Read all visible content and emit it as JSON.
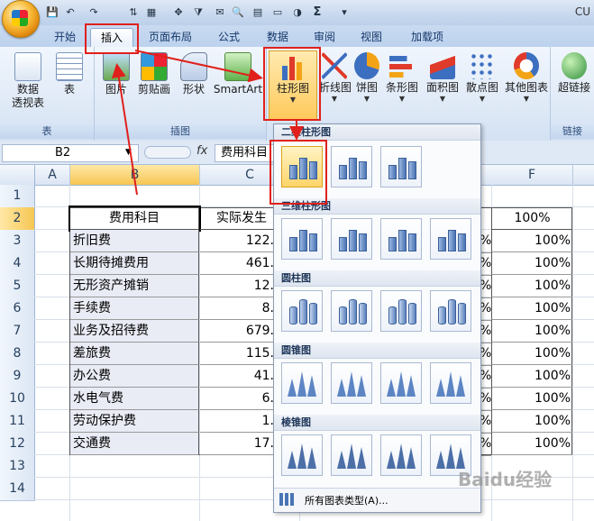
{
  "title_bar": {
    "app_title": "CU"
  },
  "tabs": [
    "开始",
    "插入",
    "页面布局",
    "公式",
    "数据",
    "审阅",
    "视图",
    "加载项"
  ],
  "ribbon": {
    "groups": {
      "table": {
        "label": "表",
        "buttons": [
          "数据\n透视表",
          "表"
        ]
      },
      "illustrations": {
        "label": "插图",
        "buttons": [
          "图片",
          "剪贴画",
          "形状",
          "SmartArt"
        ]
      },
      "charts": {
        "buttons": [
          "柱形图",
          "折线图",
          "饼图",
          "条形图",
          "面积图",
          "散点图",
          "其他图表"
        ]
      },
      "links": {
        "label": "链接",
        "buttons": [
          "超链接"
        ]
      }
    }
  },
  "formula_bar": {
    "name_box": "B2",
    "fx": "fx",
    "content": "费用科目"
  },
  "columns": [
    "A",
    "B",
    "C",
    "F"
  ],
  "rows": [
    "1",
    "2",
    "3",
    "4",
    "5",
    "6",
    "7",
    "8",
    "9",
    "10",
    "11",
    "12",
    "13",
    "14"
  ],
  "table": {
    "header_b": "费用科目",
    "header_c": "实际发生",
    "header_f": "100%",
    "rows": [
      {
        "b": "折旧费",
        "c": "122.",
        "e": "%",
        "f": "100%"
      },
      {
        "b": "长期待摊费用",
        "c": "461.",
        "e": "%",
        "f": "100%"
      },
      {
        "b": "无形资产摊销",
        "c": "12.",
        "e": "%",
        "f": "100%"
      },
      {
        "b": "手续费",
        "c": "8.",
        "e": "%",
        "f": "100%"
      },
      {
        "b": "业务及招待费",
        "c": "679.",
        "e": "%",
        "f": "100%"
      },
      {
        "b": "差旅费",
        "c": "115.",
        "e": "%",
        "f": "100%"
      },
      {
        "b": "办公费",
        "c": "41.",
        "e": "%",
        "f": "100%"
      },
      {
        "b": "水电气费",
        "c": "6.",
        "e": "%",
        "f": "100%"
      },
      {
        "b": "劳动保护费",
        "c": "1.",
        "e": "%",
        "f": "100%"
      },
      {
        "b": "交通费",
        "c": "17.",
        "e": "%",
        "f": "100%"
      }
    ]
  },
  "gallery": {
    "sections": [
      "二维柱形图",
      "三维柱形图",
      "圆柱图",
      "圆锥图",
      "棱锥图"
    ],
    "all_chart_types": "所有图表类型(A)..."
  },
  "watermark": "Baidu经验",
  "colors": {
    "annotation_red": "#e0201b",
    "ribbon_blue": "#dde8f6"
  }
}
